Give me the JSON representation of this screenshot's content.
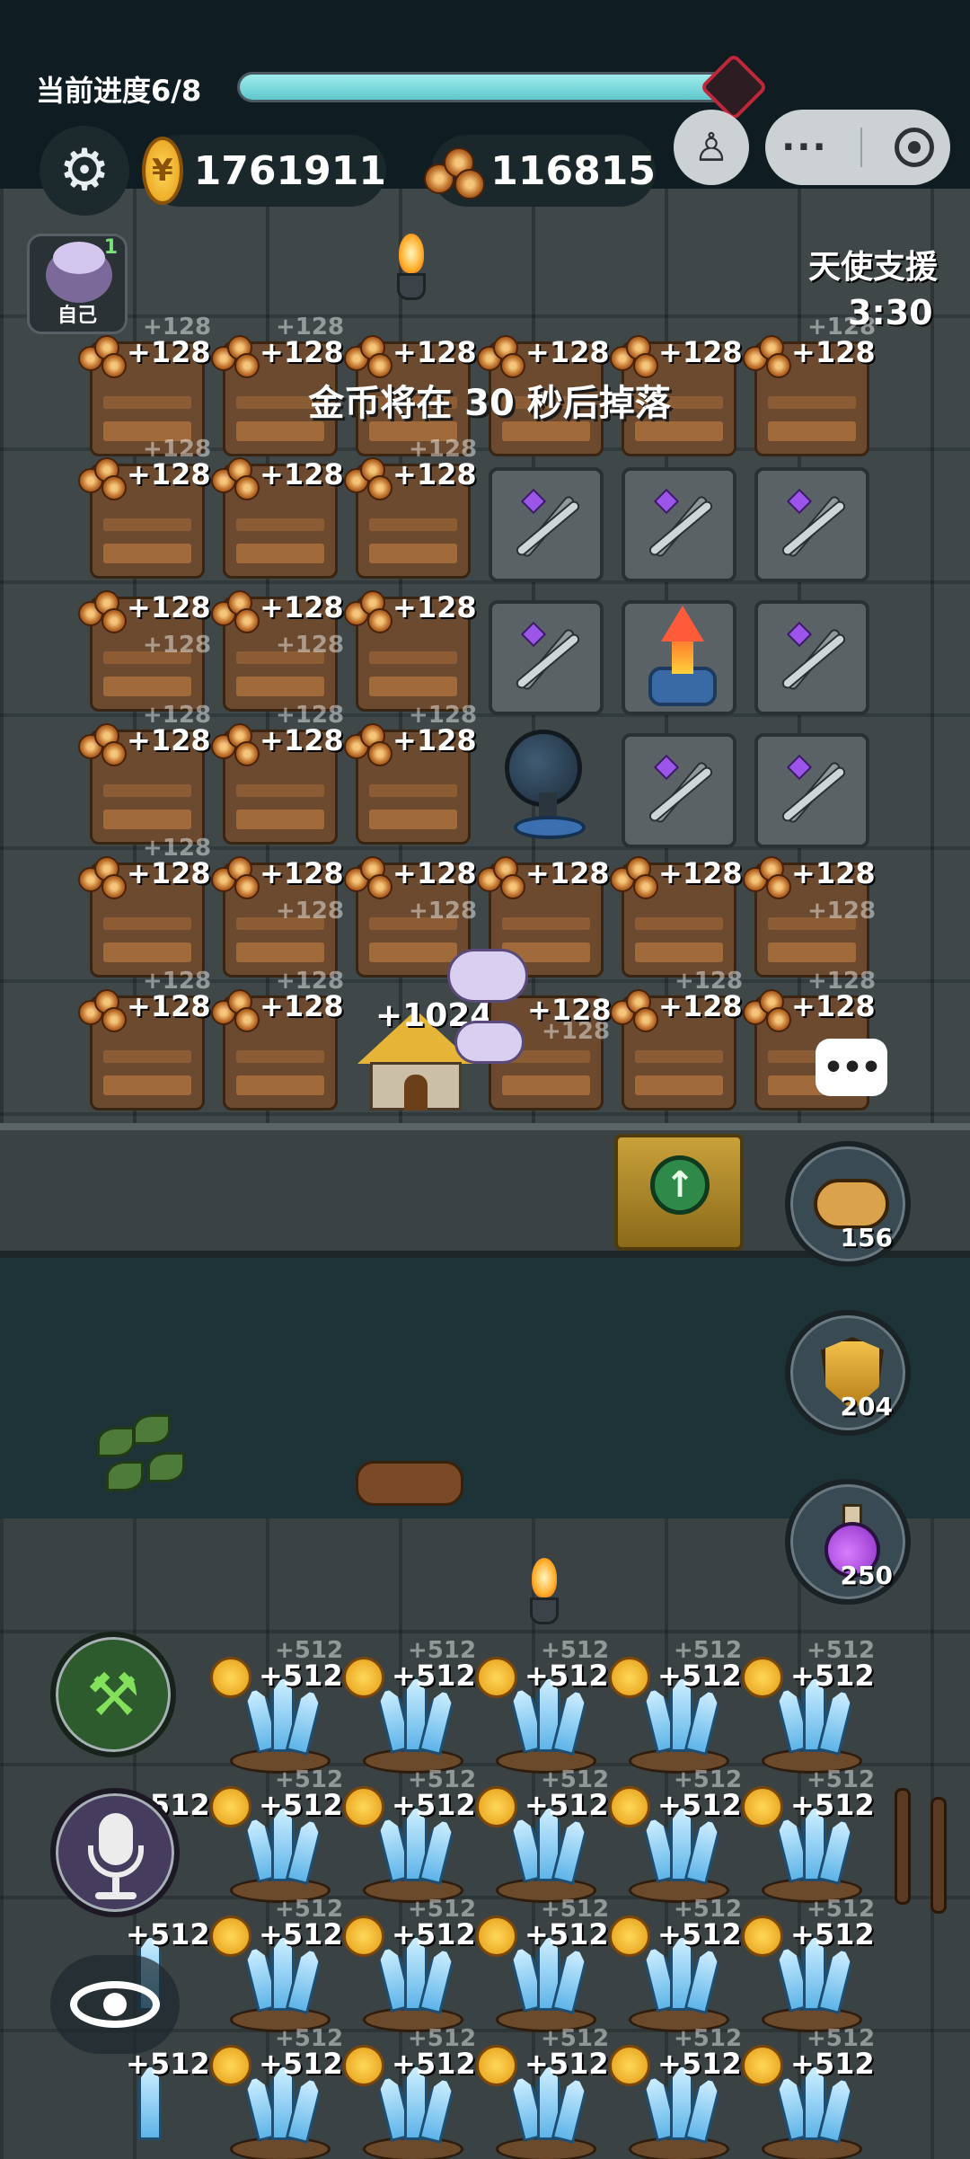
{
  "hud": {
    "progress_label": "当前进度6/8",
    "progress_value": 0.95,
    "gold": "1761911",
    "wood": "116815"
  },
  "icons": {
    "settings": "gear-icon",
    "gold": "coin-icon",
    "wood": "wood-logs-icon",
    "joystick": "joystick-icon",
    "menu": "more-dots-icon",
    "close": "target-icon"
  },
  "player": {
    "label": "自己",
    "badge": "1"
  },
  "angel_support": {
    "title": "天使支援",
    "timer": "3:30"
  },
  "notice": "金币将在 30 秒后掉落",
  "tile_yield": "+128",
  "tile_yield_cut": "+128",
  "house_yield": "+1024",
  "crystal_yield": "+512",
  "side_buttons": {
    "pig_count": "156",
    "shield_count": "204",
    "potion_count": "250"
  },
  "colors": {
    "progress_fill": "#5fc7cc",
    "gold": "#f0b323",
    "crystal": "#7ec8f0"
  }
}
